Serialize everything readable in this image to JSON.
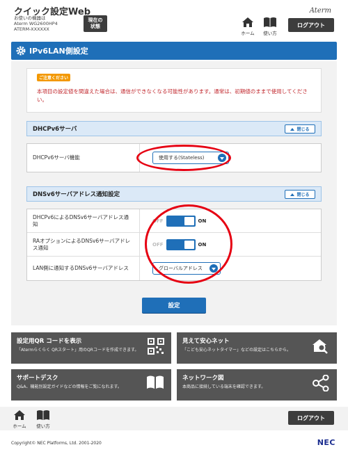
{
  "header": {
    "app_title": "クイック設定Web",
    "device_info_line1": "お使いの機器は",
    "device_info_line2": "Aterm WG2600HP4",
    "device_info_line3": "ATERM-XXXXXX",
    "status_button_line1": "現在の",
    "status_button_line2": "状態",
    "brand": "Aterm",
    "home_label": "ホーム",
    "help_label": "使い方",
    "logout_label": "ログアウト"
  },
  "page": {
    "title": "IPv6LAN側設定"
  },
  "notice": {
    "badge": "ご注意ください",
    "text": "本項目の設定値を間違えた場合は、通信ができなくなる可能性があります。通常は、初期値のままで使用してください。"
  },
  "dhcpv6_section": {
    "title": "DHCPv6サーバ",
    "collapse_label": "閉じる",
    "rows": [
      {
        "label": "DHCPv6サーバ機能",
        "value": "使用する(Stateless)"
      }
    ]
  },
  "dns_section": {
    "title": "DNSv6サーバアドレス通知設定",
    "collapse_label": "閉じる",
    "rows": [
      {
        "label": "DHCPv6によるDNSv6サーバアドレス通知",
        "off_label": "OFF",
        "on_label": "ON"
      },
      {
        "label": "RAオプションによるDNSv6サーバアドレス通知",
        "off_label": "OFF",
        "on_label": "ON"
      },
      {
        "label": "LAN側に通知するDNSv6サーバアドレス",
        "value": "グローバルアドレス"
      }
    ]
  },
  "submit_label": "設定",
  "cards": [
    {
      "title": "設定用QR コードを表示",
      "desc": "「Atermらくらく QRスタート」用のQRコードを作成できます。"
    },
    {
      "title": "見えて安心ネット",
      "desc": "「こども安心ネットタイマー」などの設定はこちらから。"
    },
    {
      "title": "サポートデスク",
      "desc": "Q&A、機能別設定ガイドなどの情報をご覧になれます。"
    },
    {
      "title": "ネットワーク図",
      "desc": "本商品に接続している端末を確認できます。"
    }
  ],
  "footer": {
    "home_label": "ホーム",
    "help_label": "使い方",
    "logout_label": "ログアウト",
    "copyright": "Copyright© NEC Platforms, Ltd. 2001-2020",
    "logo": "NEC"
  },
  "colors": {
    "accent": "#1f6fb8",
    "dark_button": "#3d3d3d",
    "warning": "#c1272d",
    "badge": "#f39800",
    "highlight_circle": "#e60012"
  }
}
